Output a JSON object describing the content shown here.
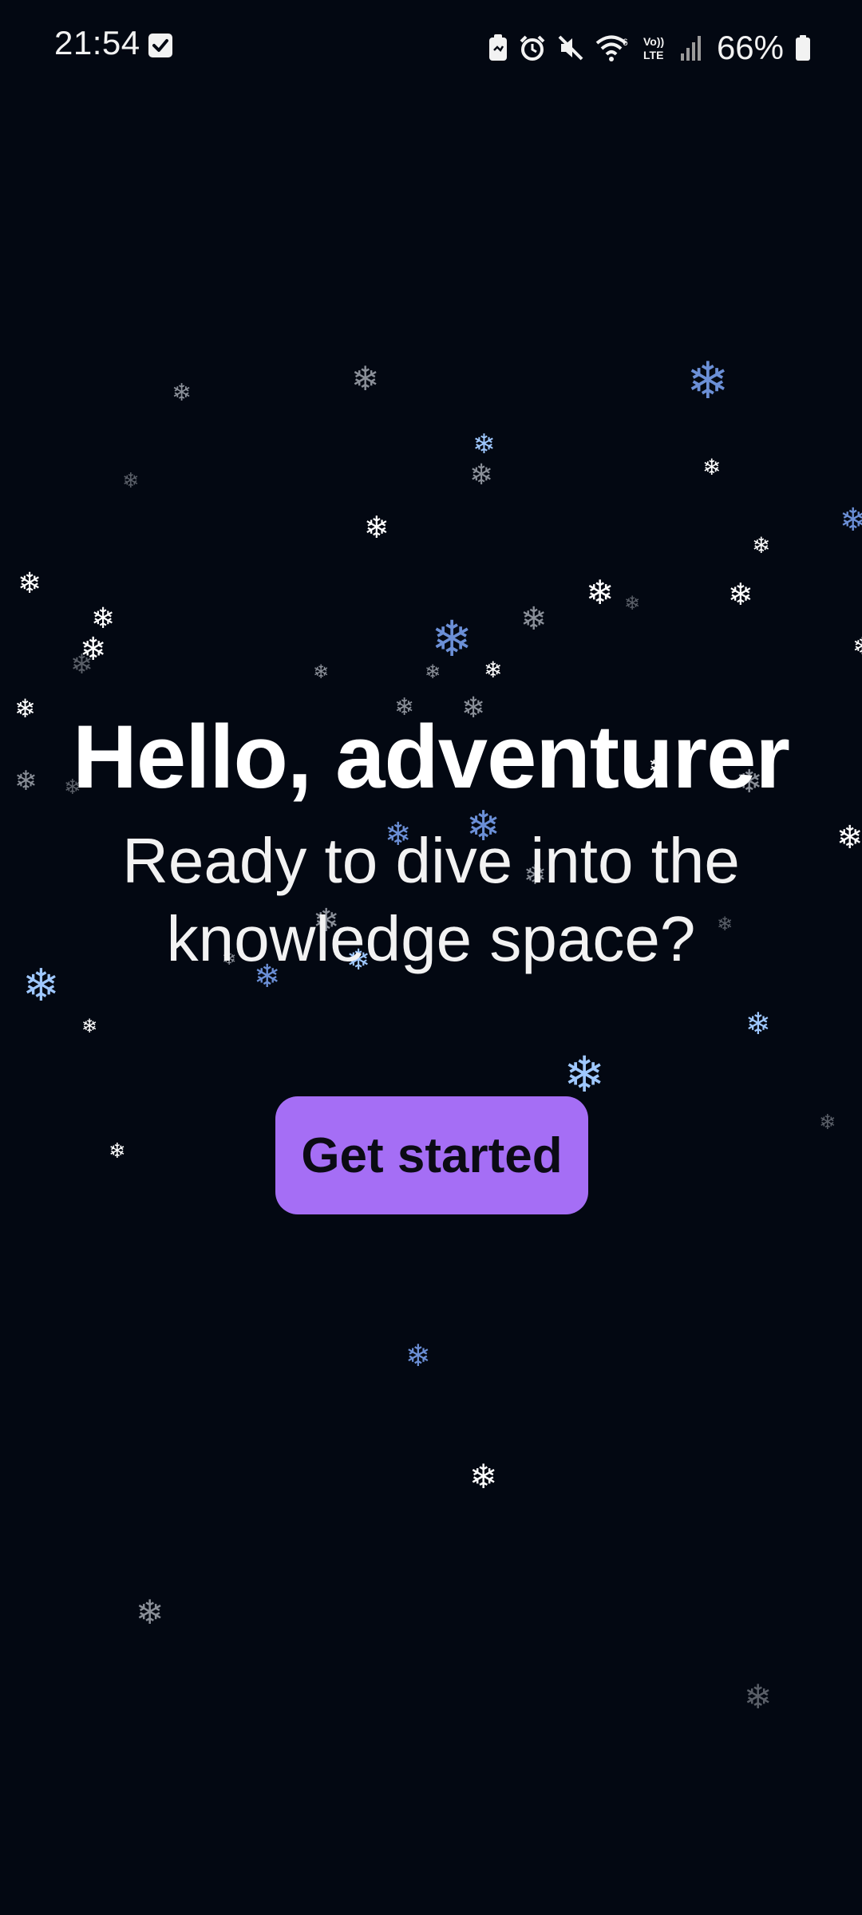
{
  "status_bar": {
    "time": "21:54",
    "battery_percent": "66%",
    "icons": [
      "check-square-icon",
      "clipboard-icon",
      "alarm-icon",
      "mute-icon",
      "wifi-icon",
      "volte-icon",
      "signal-icon",
      "battery-icon"
    ]
  },
  "main": {
    "headline": "Hello, adventurer",
    "subtitle": "Ready to dive into the knowledge space?",
    "cta_label": "Get started"
  },
  "decoration": {
    "snowflake_glyph": "❄",
    "colors": {
      "background": "#030812",
      "accent": "#a56ef5",
      "flake_white": "#ffffff",
      "flake_blue": "#9fc8ff"
    }
  }
}
